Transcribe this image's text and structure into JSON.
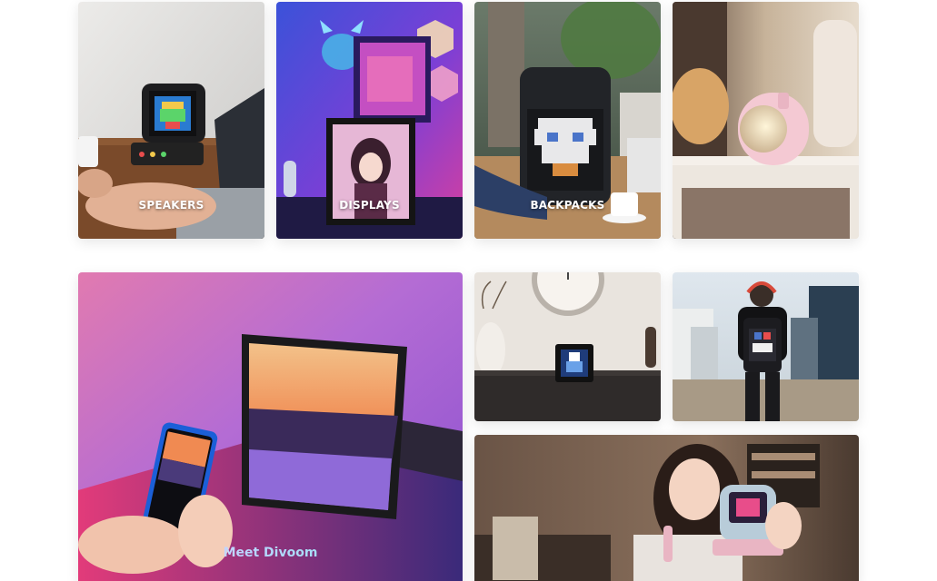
{
  "grid": {
    "top_row": [
      {
        "label": "SPEAKERS",
        "scene": "pixel-art speaker on desk beside laptop"
      },
      {
        "label": "DISPLAYS",
        "scene": "anime pixel frame in neon gaming room"
      },
      {
        "label": "BACKPACKS",
        "scene": "pixel display backpack on café table"
      },
      {
        "label": "",
        "scene": "pink lamp speaker on wooden shelf"
      }
    ],
    "feature": {
      "label": "Meet Divoom",
      "scene": "large pixel frame with sunset and phone app"
    },
    "small_tiles": [
      {
        "label": "",
        "scene": "small pixel cube on console under clock"
      },
      {
        "label": "",
        "scene": "man wearing pixel backpack in city"
      },
      {
        "label": "",
        "scene": "woman holding retro speaker with microphone in café"
      }
    ]
  },
  "colors": {
    "page_background": "#ffffff",
    "label_text": "#ffffff",
    "feature_gradient": [
      "#f7d2ff",
      "#b9d6ff",
      "#7ff0e2"
    ]
  }
}
